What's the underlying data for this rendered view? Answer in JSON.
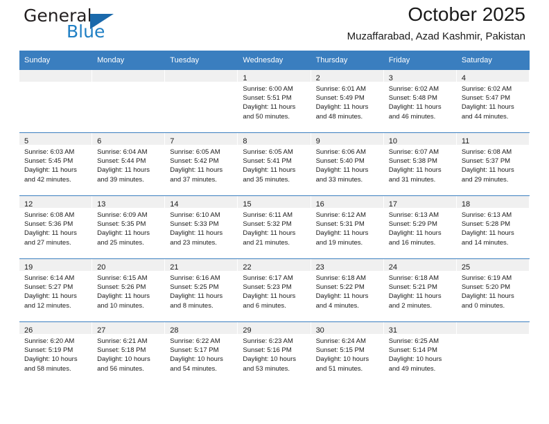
{
  "brand": {
    "name_top": "General",
    "name_bottom": "Blue",
    "accent_color": "#1a69ab",
    "blue_text_color": "#1f7fc4"
  },
  "header": {
    "title": "October 2025",
    "subtitle": "Muzaffarabad, Azad Kashmir, Pakistan"
  },
  "colors": {
    "header_row_bg": "#3a7ebf",
    "daynum_band_bg": "#f0f0f0",
    "row_separator": "#3a7ebf",
    "text": "#1a1a1a"
  },
  "weekdays": [
    "Sunday",
    "Monday",
    "Tuesday",
    "Wednesday",
    "Thursday",
    "Friday",
    "Saturday"
  ],
  "labels": {
    "sunrise_prefix": "Sunrise:",
    "sunset_prefix": "Sunset:",
    "daylight_prefix": "Daylight:"
  },
  "weeks": [
    [
      {
        "empty": true
      },
      {
        "empty": true
      },
      {
        "empty": true
      },
      {
        "day": "1",
        "l1": "Sunrise: 6:00 AM",
        "l2": "Sunset: 5:51 PM",
        "l3": "Daylight: 11 hours",
        "l4": "and 50 minutes."
      },
      {
        "day": "2",
        "l1": "Sunrise: 6:01 AM",
        "l2": "Sunset: 5:49 PM",
        "l3": "Daylight: 11 hours",
        "l4": "and 48 minutes."
      },
      {
        "day": "3",
        "l1": "Sunrise: 6:02 AM",
        "l2": "Sunset: 5:48 PM",
        "l3": "Daylight: 11 hours",
        "l4": "and 46 minutes."
      },
      {
        "day": "4",
        "l1": "Sunrise: 6:02 AM",
        "l2": "Sunset: 5:47 PM",
        "l3": "Daylight: 11 hours",
        "l4": "and 44 minutes."
      }
    ],
    [
      {
        "day": "5",
        "l1": "Sunrise: 6:03 AM",
        "l2": "Sunset: 5:45 PM",
        "l3": "Daylight: 11 hours",
        "l4": "and 42 minutes."
      },
      {
        "day": "6",
        "l1": "Sunrise: 6:04 AM",
        "l2": "Sunset: 5:44 PM",
        "l3": "Daylight: 11 hours",
        "l4": "and 39 minutes."
      },
      {
        "day": "7",
        "l1": "Sunrise: 6:05 AM",
        "l2": "Sunset: 5:42 PM",
        "l3": "Daylight: 11 hours",
        "l4": "and 37 minutes."
      },
      {
        "day": "8",
        "l1": "Sunrise: 6:05 AM",
        "l2": "Sunset: 5:41 PM",
        "l3": "Daylight: 11 hours",
        "l4": "and 35 minutes."
      },
      {
        "day": "9",
        "l1": "Sunrise: 6:06 AM",
        "l2": "Sunset: 5:40 PM",
        "l3": "Daylight: 11 hours",
        "l4": "and 33 minutes."
      },
      {
        "day": "10",
        "l1": "Sunrise: 6:07 AM",
        "l2": "Sunset: 5:38 PM",
        "l3": "Daylight: 11 hours",
        "l4": "and 31 minutes."
      },
      {
        "day": "11",
        "l1": "Sunrise: 6:08 AM",
        "l2": "Sunset: 5:37 PM",
        "l3": "Daylight: 11 hours",
        "l4": "and 29 minutes."
      }
    ],
    [
      {
        "day": "12",
        "l1": "Sunrise: 6:08 AM",
        "l2": "Sunset: 5:36 PM",
        "l3": "Daylight: 11 hours",
        "l4": "and 27 minutes."
      },
      {
        "day": "13",
        "l1": "Sunrise: 6:09 AM",
        "l2": "Sunset: 5:35 PM",
        "l3": "Daylight: 11 hours",
        "l4": "and 25 minutes."
      },
      {
        "day": "14",
        "l1": "Sunrise: 6:10 AM",
        "l2": "Sunset: 5:33 PM",
        "l3": "Daylight: 11 hours",
        "l4": "and 23 minutes."
      },
      {
        "day": "15",
        "l1": "Sunrise: 6:11 AM",
        "l2": "Sunset: 5:32 PM",
        "l3": "Daylight: 11 hours",
        "l4": "and 21 minutes."
      },
      {
        "day": "16",
        "l1": "Sunrise: 6:12 AM",
        "l2": "Sunset: 5:31 PM",
        "l3": "Daylight: 11 hours",
        "l4": "and 19 minutes."
      },
      {
        "day": "17",
        "l1": "Sunrise: 6:13 AM",
        "l2": "Sunset: 5:29 PM",
        "l3": "Daylight: 11 hours",
        "l4": "and 16 minutes."
      },
      {
        "day": "18",
        "l1": "Sunrise: 6:13 AM",
        "l2": "Sunset: 5:28 PM",
        "l3": "Daylight: 11 hours",
        "l4": "and 14 minutes."
      }
    ],
    [
      {
        "day": "19",
        "l1": "Sunrise: 6:14 AM",
        "l2": "Sunset: 5:27 PM",
        "l3": "Daylight: 11 hours",
        "l4": "and 12 minutes."
      },
      {
        "day": "20",
        "l1": "Sunrise: 6:15 AM",
        "l2": "Sunset: 5:26 PM",
        "l3": "Daylight: 11 hours",
        "l4": "and 10 minutes."
      },
      {
        "day": "21",
        "l1": "Sunrise: 6:16 AM",
        "l2": "Sunset: 5:25 PM",
        "l3": "Daylight: 11 hours",
        "l4": "and 8 minutes."
      },
      {
        "day": "22",
        "l1": "Sunrise: 6:17 AM",
        "l2": "Sunset: 5:23 PM",
        "l3": "Daylight: 11 hours",
        "l4": "and 6 minutes."
      },
      {
        "day": "23",
        "l1": "Sunrise: 6:18 AM",
        "l2": "Sunset: 5:22 PM",
        "l3": "Daylight: 11 hours",
        "l4": "and 4 minutes."
      },
      {
        "day": "24",
        "l1": "Sunrise: 6:18 AM",
        "l2": "Sunset: 5:21 PM",
        "l3": "Daylight: 11 hours",
        "l4": "and 2 minutes."
      },
      {
        "day": "25",
        "l1": "Sunrise: 6:19 AM",
        "l2": "Sunset: 5:20 PM",
        "l3": "Daylight: 11 hours",
        "l4": "and 0 minutes."
      }
    ],
    [
      {
        "day": "26",
        "l1": "Sunrise: 6:20 AM",
        "l2": "Sunset: 5:19 PM",
        "l3": "Daylight: 10 hours",
        "l4": "and 58 minutes."
      },
      {
        "day": "27",
        "l1": "Sunrise: 6:21 AM",
        "l2": "Sunset: 5:18 PM",
        "l3": "Daylight: 10 hours",
        "l4": "and 56 minutes."
      },
      {
        "day": "28",
        "l1": "Sunrise: 6:22 AM",
        "l2": "Sunset: 5:17 PM",
        "l3": "Daylight: 10 hours",
        "l4": "and 54 minutes."
      },
      {
        "day": "29",
        "l1": "Sunrise: 6:23 AM",
        "l2": "Sunset: 5:16 PM",
        "l3": "Daylight: 10 hours",
        "l4": "and 53 minutes."
      },
      {
        "day": "30",
        "l1": "Sunrise: 6:24 AM",
        "l2": "Sunset: 5:15 PM",
        "l3": "Daylight: 10 hours",
        "l4": "and 51 minutes."
      },
      {
        "day": "31",
        "l1": "Sunrise: 6:25 AM",
        "l2": "Sunset: 5:14 PM",
        "l3": "Daylight: 10 hours",
        "l4": "and 49 minutes."
      },
      {
        "empty": true
      }
    ]
  ]
}
